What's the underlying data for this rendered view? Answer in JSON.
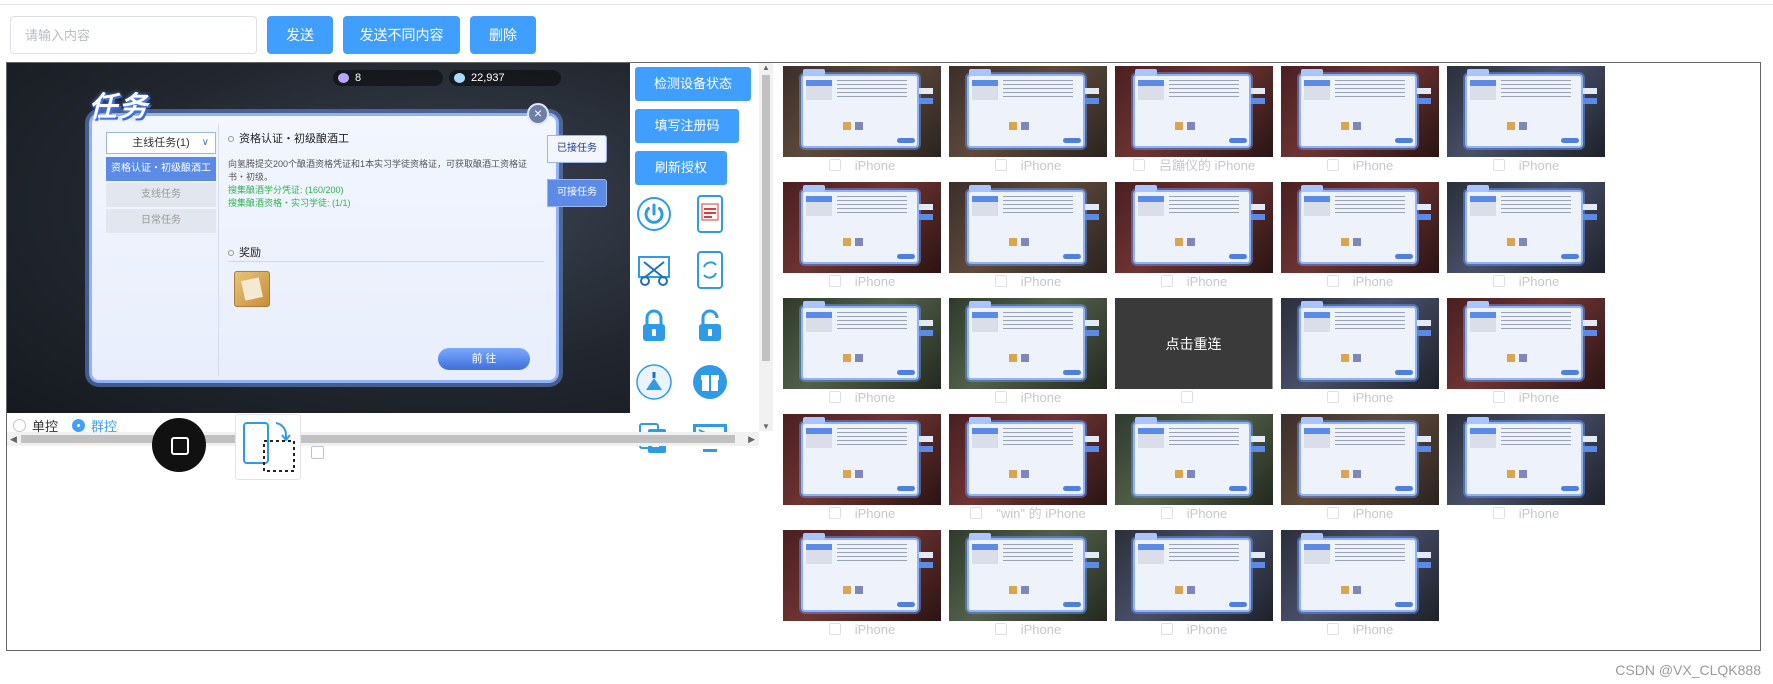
{
  "toolbar": {
    "input_placeholder": "请输入内容",
    "send_label": "发送",
    "send_diff_label": "发送不同内容",
    "delete_label": "删除"
  },
  "game": {
    "gem_count": "8",
    "crystal_count": "22,937",
    "panel_title": "任务",
    "dropdown_label": "主线任务(1)",
    "side_tabs": [
      "资格认证・初级酿酒工",
      "支线任务",
      "日常任务"
    ],
    "quest_title": "资格认证・初级酿酒工",
    "quest_desc": "向氢腾提交200个酿酒资格凭证和1本实习学徒资格证，可获取酿酒工资格证书・初级。",
    "quest_progress_1": "搜集酿酒学分凭证: (160/200)",
    "quest_progress_2": "搜集酿酒资格・实习学徒: (1/1)",
    "reward_label": "奖励",
    "goto_label": "前 往",
    "right_tab_1": "已接任务",
    "right_tab_2": "可接任务"
  },
  "commands": {
    "check_status": "检测设备状态",
    "fill_code": "填写注册码",
    "refresh_auth": "刷新授权"
  },
  "icons": [
    "power-icon",
    "screen-record-icon",
    "screenshot-icon",
    "rotate-screen-icon",
    "lock-icon",
    "unlock-icon",
    "clean-icon",
    "gift-icon",
    "copy-icon",
    "monitor-icon"
  ],
  "mode": {
    "single_label": "单控",
    "group_label": "群控",
    "selected": "群控"
  },
  "devices": [
    {
      "label": "iPhone",
      "theme": "t1"
    },
    {
      "label": "iPhone",
      "theme": "t1"
    },
    {
      "label": "吕蹦仪的 iPhone",
      "theme": "t3"
    },
    {
      "label": "iPhone",
      "theme": "t3"
    },
    {
      "label": "iPhone",
      "theme": "t4"
    },
    {
      "label": "iPhone",
      "theme": "t3"
    },
    {
      "label": "iPhone",
      "theme": "t1"
    },
    {
      "label": "iPhone",
      "theme": "t3"
    },
    {
      "label": "iPhone",
      "theme": "t3"
    },
    {
      "label": "iPhone",
      "theme": "t4"
    },
    {
      "label": "iPhone",
      "theme": "t2"
    },
    {
      "label": "iPhone",
      "theme": "t2"
    },
    {
      "label": "",
      "theme": "reconnect",
      "reconnect_text": "点击重连"
    },
    {
      "label": "iPhone",
      "theme": "t4"
    },
    {
      "label": "iPhone",
      "theme": "t3"
    },
    {
      "label": "iPhone",
      "theme": "t3"
    },
    {
      "label": "\"win\" 的 iPhone",
      "theme": "t3"
    },
    {
      "label": "iPhone",
      "theme": "t2"
    },
    {
      "label": "iPhone",
      "theme": "t1"
    },
    {
      "label": "iPhone",
      "theme": "t4"
    },
    {
      "label": "iPhone",
      "theme": "t3"
    },
    {
      "label": "iPhone",
      "theme": "t2"
    },
    {
      "label": "iPhone",
      "theme": "t4"
    },
    {
      "label": "iPhone",
      "theme": "t4"
    }
  ],
  "watermark": "CSDN @VX_CLQK888",
  "colors": {
    "primary": "#409eff",
    "border": "#666666",
    "label_gray": "#c4c7cc"
  }
}
